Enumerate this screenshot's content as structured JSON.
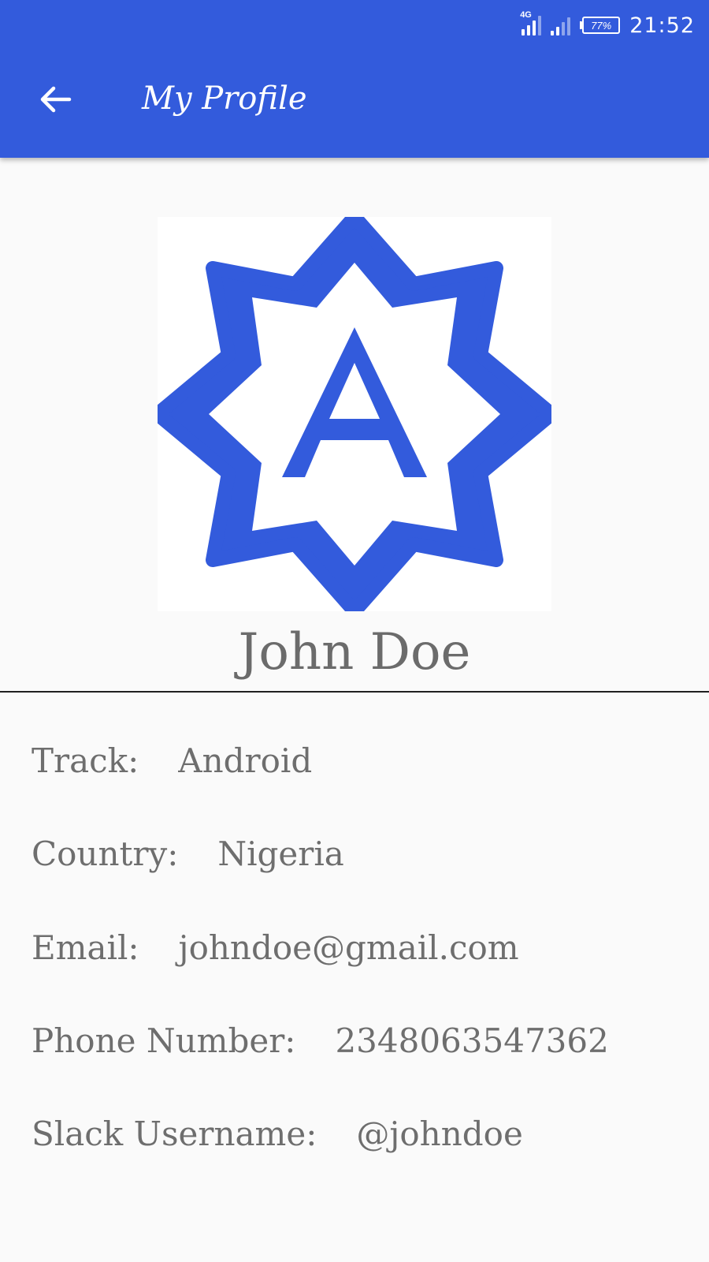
{
  "status_bar": {
    "network": "4G",
    "battery": "77%",
    "time": "21:52"
  },
  "app_bar": {
    "title": "My Profile",
    "back_icon": "arrow-left-icon"
  },
  "profile": {
    "logo_icon": "star-badge-a-logo",
    "logo_letter": "A",
    "name": "John Doe"
  },
  "details": [
    {
      "label": "Track:",
      "value": "Android"
    },
    {
      "label": "Country:",
      "value": "Nigeria"
    },
    {
      "label": "Email:",
      "value": "johndoe@gmail.com"
    },
    {
      "label": "Phone Number:",
      "value": "2348063547362"
    },
    {
      "label": "Slack Username:",
      "value": "@johndoe"
    }
  ],
  "colors": {
    "primary": "#335bdc",
    "text_gray": "#6e6e6e",
    "background": "#fafafa"
  }
}
